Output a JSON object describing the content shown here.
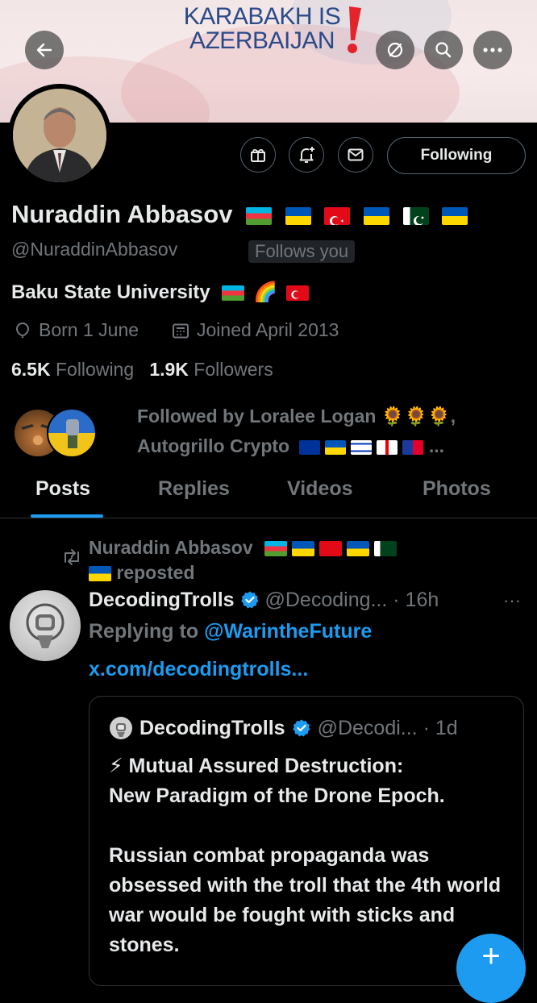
{
  "banner": {
    "line1": "KARABAKH IS",
    "line2": "AZERBAIJAN",
    "exclaim": "!"
  },
  "toolbar": {
    "back_icon": "arrow-left-icon",
    "grok_icon": "slash-circle-icon",
    "search_icon": "search-icon",
    "more_icon": "more-icon"
  },
  "profile": {
    "name": "Nuraddin Abbasov",
    "name_flags": [
      "az",
      "ua",
      "tr",
      "ua",
      "pk",
      "ua"
    ],
    "handle": "@NuraddinAbbasov",
    "follows_you": "Follows you",
    "bio": "Baku State University",
    "bio_emoji": "🌈",
    "born": "Born 1 June",
    "joined": "Joined April 2013",
    "following_count": "6.5K",
    "following_label": "Following",
    "followers_count": "1.9K",
    "followers_label": "Followers",
    "follow_button": "Following",
    "followed_by_line1": "Followed by Loralee Logan 🌻🌻🌻,",
    "followed_by_line2_name": "Autogrillo Crypto",
    "followed_by_line2_suffix": "..."
  },
  "tabs": [
    {
      "label": "Posts",
      "active": true
    },
    {
      "label": "Replies",
      "active": false
    },
    {
      "label": "Videos",
      "active": false
    },
    {
      "label": "Photos",
      "active": false
    }
  ],
  "post": {
    "repost_name": "Nuraddin Abbasov",
    "repost_label": "reposted",
    "author": "DecodingTrolls",
    "handle_time": "@Decoding... · 16h",
    "more": "···",
    "replying_prefix": "Replying to",
    "replying_to": "@WarintheFuture",
    "link": "x.com/decodingtrolls...",
    "quote": {
      "author": "DecodingTrolls",
      "handle_time": "@Decodi... · 1d",
      "emoji": "⚡",
      "text_line1": "Mutual Assured Destruction:",
      "text_line2": "New Paradigm of the Drone Epoch.",
      "text_para2": "Russian combat propaganda was obsessed with the troll that the 4th world war would be fought with sticks and stones."
    }
  },
  "fab": {
    "label": "+"
  },
  "colors": {
    "accent": "#1d9bf0",
    "muted": "#71767b",
    "text": "#e7e9ea",
    "border": "#2f3336"
  }
}
